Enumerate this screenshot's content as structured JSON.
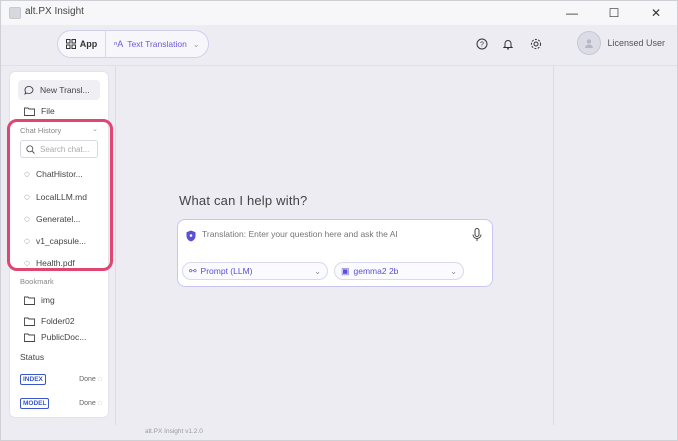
{
  "window": {
    "title": "alt.PX Insight",
    "controls": {
      "minimize": "—",
      "maximize": "☐",
      "close": "✕"
    }
  },
  "topbar": {
    "app_label": "App",
    "mode_label": "Text Translation",
    "user_name": "Licensed User"
  },
  "sidebar": {
    "new_translation": "New Transl...",
    "file": "File",
    "chat_history": {
      "title": "Chat History",
      "search_placeholder": "Search chat...",
      "items": [
        "ChatHistor...",
        "LocalLLM.md",
        "Generatel...",
        "v1_capsule...",
        "Health.pdf"
      ]
    },
    "bookmark": {
      "title": "Bookmark",
      "items": [
        "img",
        "Folder02",
        "PublicDoc..."
      ]
    },
    "status": {
      "title": "Status",
      "rows": [
        {
          "badge": "INDEX",
          "value": "Done"
        },
        {
          "badge": "MODEL",
          "value": "Done"
        }
      ]
    }
  },
  "main": {
    "heading": "What can I help with?",
    "composer": {
      "placeholder": "Translation: Enter your question here and ask the AI",
      "prompt_select": "Prompt (LLM)",
      "model_select": "gemma2 2b"
    }
  },
  "footer": {
    "version": "alt.PX Insight v1.2.0"
  },
  "colors": {
    "accent": "#5b4fd6",
    "highlight": "#e04672",
    "status_badge": "#3a56c9"
  }
}
